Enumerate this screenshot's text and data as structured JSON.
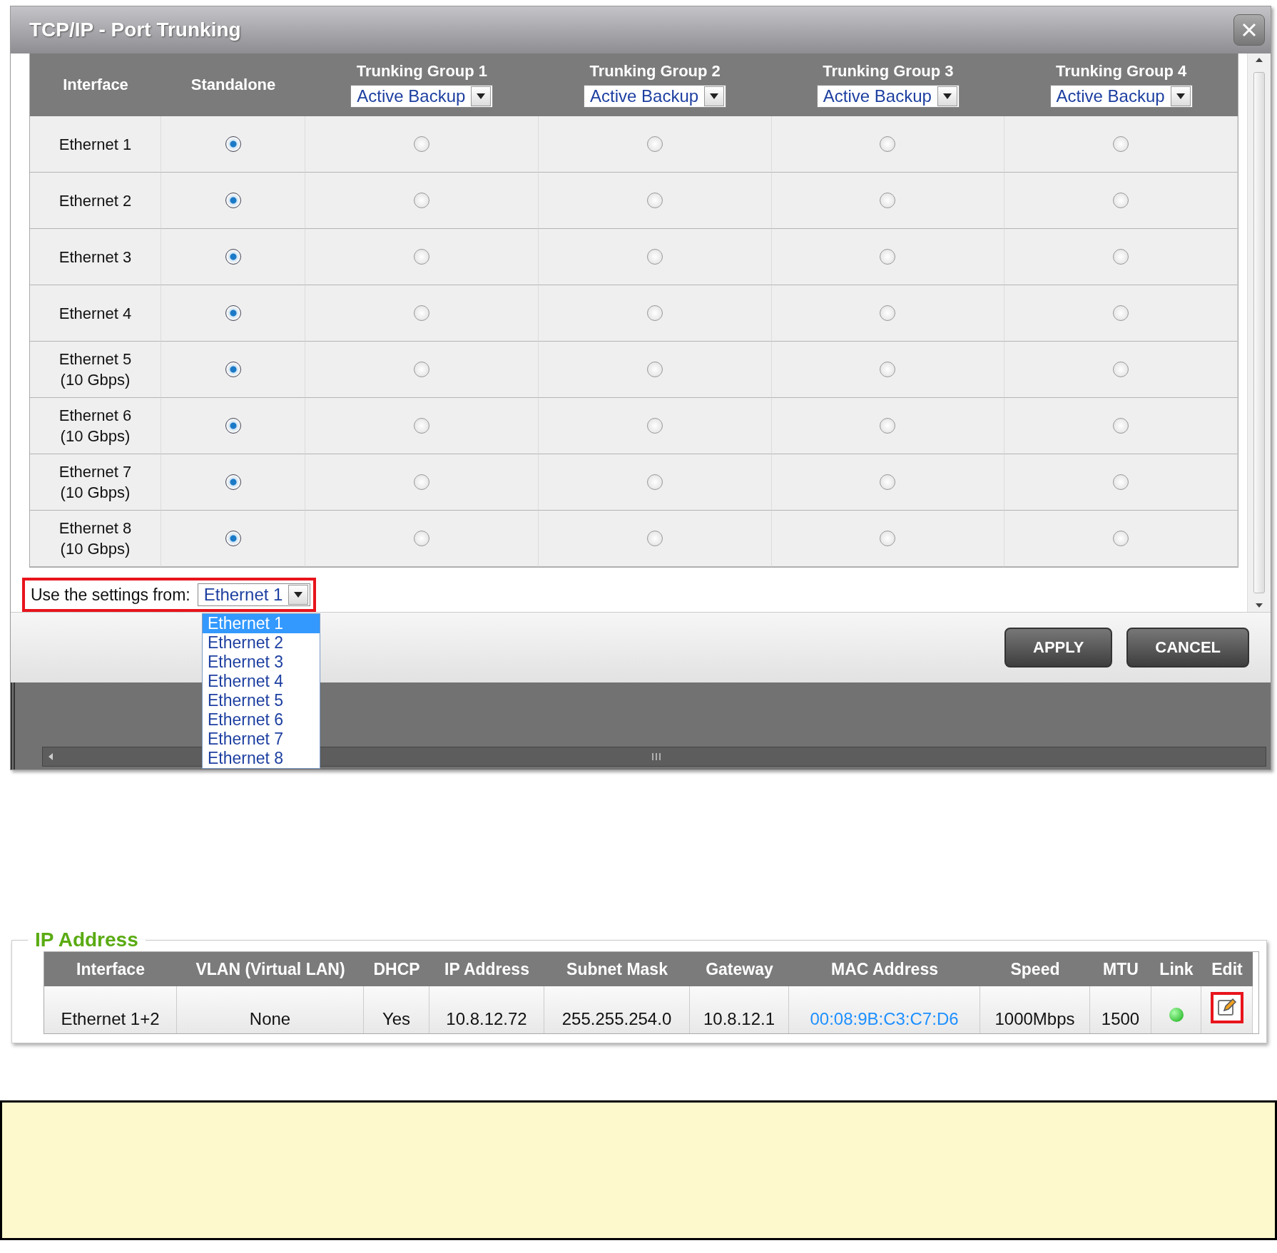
{
  "dialog": {
    "title": "TCP/IP - Port Trunking",
    "columns": {
      "interface": "Interface",
      "standalone": "Standalone"
    },
    "groups": [
      {
        "name": "Trunking Group 1",
        "mode": "Active Backup"
      },
      {
        "name": "Trunking Group 2",
        "mode": "Active Backup"
      },
      {
        "name": "Trunking Group 3",
        "mode": "Active Backup"
      },
      {
        "name": "Trunking Group 4",
        "mode": "Active Backup"
      }
    ],
    "rows": [
      {
        "name": "Ethernet 1",
        "options": [
          {
            "selected": true
          },
          {
            "selected": false
          },
          {
            "selected": false
          },
          {
            "selected": false
          },
          {
            "selected": false
          }
        ]
      },
      {
        "name": "Ethernet 2",
        "options": [
          {
            "selected": true
          },
          {
            "selected": false
          },
          {
            "selected": false
          },
          {
            "selected": false
          },
          {
            "selected": false
          }
        ]
      },
      {
        "name": "Ethernet 3",
        "options": [
          {
            "selected": true
          },
          {
            "selected": false
          },
          {
            "selected": false
          },
          {
            "selected": false
          },
          {
            "selected": false
          }
        ]
      },
      {
        "name": "Ethernet 4",
        "options": [
          {
            "selected": true
          },
          {
            "selected": false
          },
          {
            "selected": false
          },
          {
            "selected": false
          },
          {
            "selected": false
          }
        ]
      },
      {
        "name": "Ethernet 5",
        "speed": "(10 Gbps)",
        "options": [
          {
            "selected": true
          },
          {
            "selected": false
          },
          {
            "selected": false
          },
          {
            "selected": false
          },
          {
            "selected": false
          }
        ]
      },
      {
        "name": "Ethernet 6",
        "speed": "(10 Gbps)",
        "options": [
          {
            "selected": true
          },
          {
            "selected": false
          },
          {
            "selected": false
          },
          {
            "selected": false
          },
          {
            "selected": false
          }
        ]
      },
      {
        "name": "Ethernet 7",
        "speed": "(10 Gbps)",
        "options": [
          {
            "selected": true
          },
          {
            "selected": false
          },
          {
            "selected": false
          },
          {
            "selected": false
          },
          {
            "selected": false
          }
        ]
      },
      {
        "name": "Ethernet 8",
        "speed": "(10 Gbps)",
        "options": [
          {
            "selected": true
          },
          {
            "selected": false
          },
          {
            "selected": false
          },
          {
            "selected": false
          },
          {
            "selected": false
          }
        ]
      }
    ],
    "settings": {
      "label": "Use the settings from:",
      "value": "Ethernet 1",
      "highlighted": true,
      "expanded": true,
      "options": [
        {
          "label": "Ethernet 1",
          "selected": true
        },
        {
          "label": "Ethernet 2",
          "selected": false
        },
        {
          "label": "Ethernet 3",
          "selected": false
        },
        {
          "label": "Ethernet 4",
          "selected": false
        },
        {
          "label": "Ethernet 5",
          "selected": false
        },
        {
          "label": "Ethernet 6",
          "selected": false
        },
        {
          "label": "Ethernet 7",
          "selected": false
        },
        {
          "label": "Ethernet 8",
          "selected": false
        }
      ]
    },
    "buttons": [
      "APPLY",
      "CANCEL"
    ]
  },
  "ip_panel": {
    "title": "IP Address",
    "columns": [
      "Interface",
      "VLAN (Virtual LAN)",
      "DHCP",
      "IP Address",
      "Subnet Mask",
      "Gateway",
      "MAC Address",
      "Speed",
      "MTU",
      "Link",
      "Edit"
    ],
    "rows": [
      {
        "interface": "Ethernet 1+2",
        "vlan": "None",
        "dhcp": "Yes",
        "ip": "10.8.12.72",
        "subnet": "255.255.254.0",
        "gateway": "10.8.12.1",
        "mac": "00:08:9B:C3:C7:D6",
        "speed": "1000Mbps",
        "mtu": "1500",
        "link": {
          "on": true
        },
        "edit": {
          "highlighted": true
        }
      }
    ]
  }
}
